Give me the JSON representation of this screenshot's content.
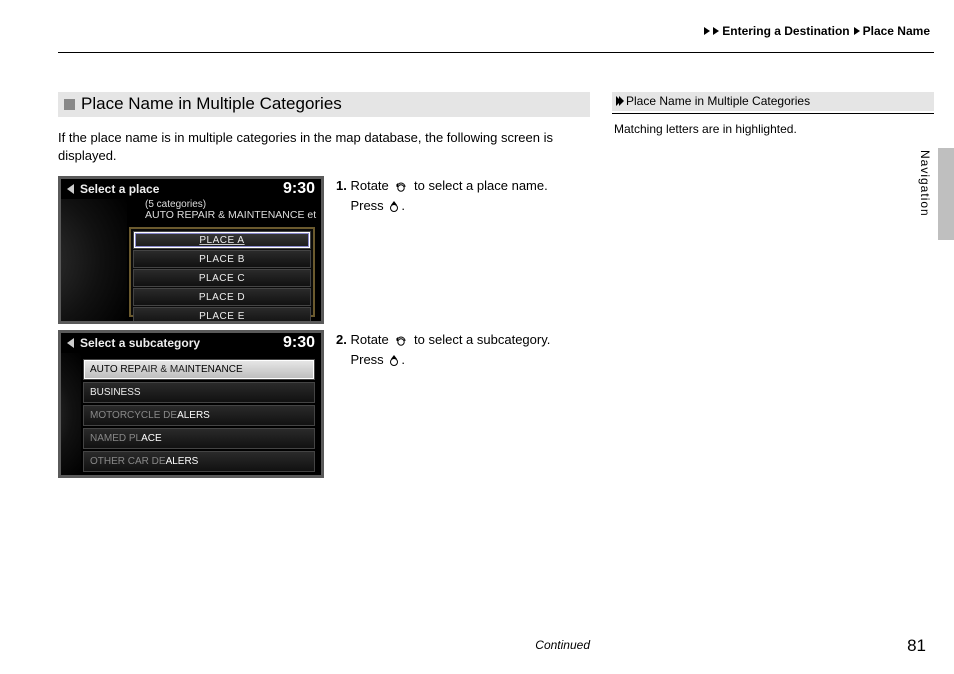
{
  "breadcrumb": {
    "level1": "Entering a Destination",
    "level2": "Place Name"
  },
  "section": {
    "title": "Place Name in Multiple Categories",
    "intro": "If the place name is in multiple categories in the map database, the following screen is displayed."
  },
  "steps": [
    {
      "num": "1.",
      "line1": "Rotate",
      "line1b": "to select a place name.",
      "line2": "Press",
      "line2b": "."
    },
    {
      "num": "2.",
      "line1": "Rotate",
      "line1b": "to select a subcategory.",
      "line2": "Press",
      "line2b": "."
    }
  ],
  "shot1": {
    "title": "Select a place",
    "time": "9:30",
    "subcount": "(5 categories)",
    "subline": "AUTO REPAIR & MAINTENANCE et",
    "items": [
      "PLACE A",
      "PLACE B",
      "PLACE C",
      "PLACE D",
      "PLACE E"
    ]
  },
  "shot2": {
    "title": "Select a subcategory",
    "time": "9:30",
    "items": [
      {
        "pre": "AUTO REP",
        "hl": "AIR & MA",
        "post": "INTENANCE",
        "sel": true
      },
      {
        "pre": "BUSINESS",
        "hl": "",
        "post": "",
        "sel": false
      },
      {
        "pre": "MOTORCYCLE DE",
        "hl": "ALERS",
        "post": "",
        "sel": false
      },
      {
        "pre": "NAMED PL",
        "hl": "ACE",
        "post": "",
        "sel": false
      },
      {
        "pre": "OTHER CAR DE",
        "hl": "ALERS",
        "post": "",
        "sel": false
      }
    ]
  },
  "sidebar": {
    "title": "Place Name in Multiple Categories",
    "note": "Matching letters are in highlighted."
  },
  "tab": {
    "label": "Navigation"
  },
  "footer": {
    "continued": "Continued",
    "page": "81"
  }
}
